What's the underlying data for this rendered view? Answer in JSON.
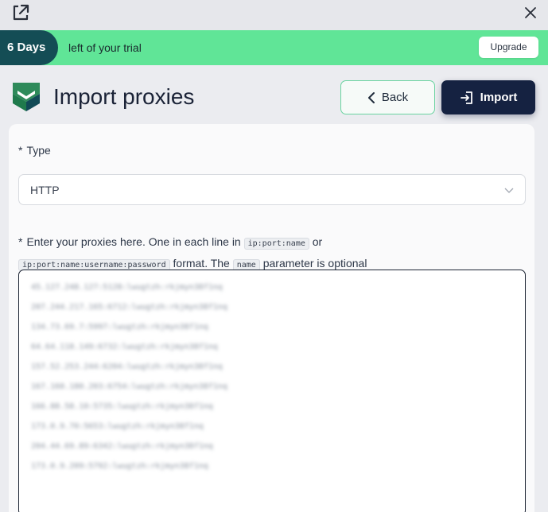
{
  "trial": {
    "days": "6 Days",
    "text": "left of your trial",
    "upgrade_label": "Upgrade"
  },
  "header": {
    "title": "Import proxies",
    "back_label": "Back",
    "import_label": "Import"
  },
  "form": {
    "type_label": "Type",
    "type_value": "HTTP",
    "hint": {
      "before": "Enter your proxies here. One in each line in",
      "code1": "ip:port:name",
      "or": "or",
      "code2": "ip:port:name:username:password",
      "middle": "format. The",
      "code3": "name",
      "after": "parameter is optional"
    },
    "proxies": [
      "45.127.248.127:5128:lwugtzh:rkjmyn38f1nq",
      "207.244.217.165:6712:lwugtzh:rkjmyn38f1nq",
      "134.73.69.7:5997:lwugtzh:rkjmyn38f1nq",
      "64.64.118.149:6732:lwugtzh:rkjmyn38f1nq",
      "157.52.253.244:6204:lwugtzh:rkjmyn38f1nq",
      "167.160.180.203:6754:lwugtzh:rkjmyn38f1nq",
      "166.88.58.10:5735:lwugtzh:rkjmyn38f1nq",
      "173.0.9.70:5653:lwugtzh:rkjmyn38f1nq",
      "204.44.69.89:6342:lwugtzh:rkjmyn38f1nq",
      "173.0.9.209:5792:lwugtzh:rkjmyn38f1nq"
    ]
  },
  "colors": {
    "trial_bar": "#60e597",
    "badge": "#144d55",
    "import_button": "#152241",
    "back_border": "#6ad3a0"
  },
  "icons": [
    "external-link-icon",
    "close-icon",
    "logo-icon",
    "chevron-left-icon",
    "import-icon",
    "chevron-down-icon"
  ]
}
